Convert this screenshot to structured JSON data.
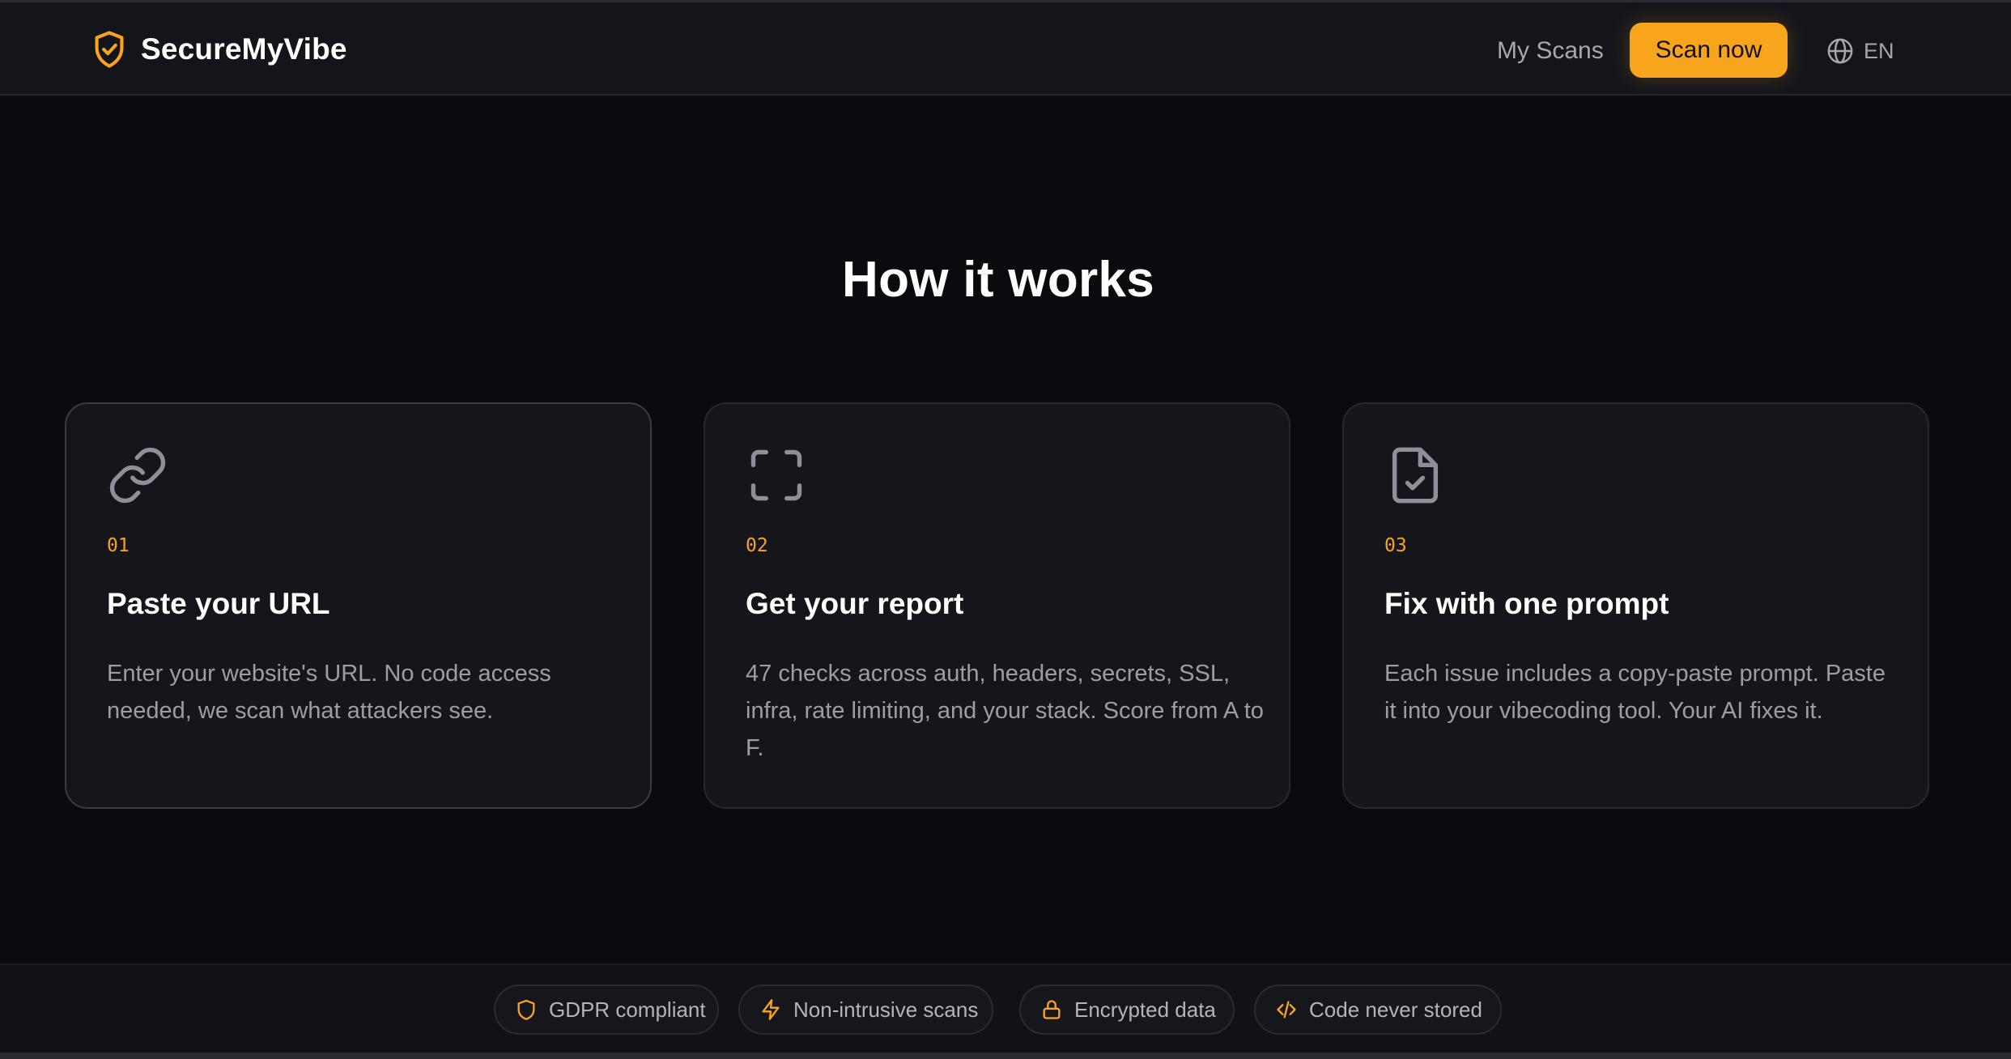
{
  "header": {
    "brand_name": "SecureMyVibe",
    "brand_icon": "shield-check-icon",
    "nav_my_scans": "My Scans",
    "scan_now_label": "Scan now",
    "language_label": "EN",
    "language_icon": "globe-icon"
  },
  "section": {
    "title": "How it works",
    "steps": [
      {
        "icon": "link-icon",
        "number": "01",
        "title": "Paste your URL",
        "description": "Enter your website's URL. No code access needed, we scan what attackers see."
      },
      {
        "icon": "scan-frame-icon",
        "number": "02",
        "title": "Get your report",
        "description": "47 checks across auth, headers, secrets, SSL, infra, rate limiting, and your stack. Score from A to F."
      },
      {
        "icon": "file-check-icon",
        "number": "03",
        "title": "Fix with one prompt",
        "description": "Each issue includes a copy-paste prompt. Paste it into your vibecoding tool. Your AI fixes it."
      }
    ]
  },
  "footer": {
    "badges": [
      {
        "icon": "shield-icon",
        "label": "GDPR compliant"
      },
      {
        "icon": "lightning-icon",
        "label": "Non-intrusive scans"
      },
      {
        "icon": "lock-icon",
        "label": "Encrypted data"
      },
      {
        "icon": "code-icon",
        "label": "Code never stored"
      }
    ]
  },
  "colors": {
    "accent": "#f8a41c",
    "background": "#0b0b0f",
    "card": "#15161c",
    "muted_text": "#9c9da6"
  }
}
